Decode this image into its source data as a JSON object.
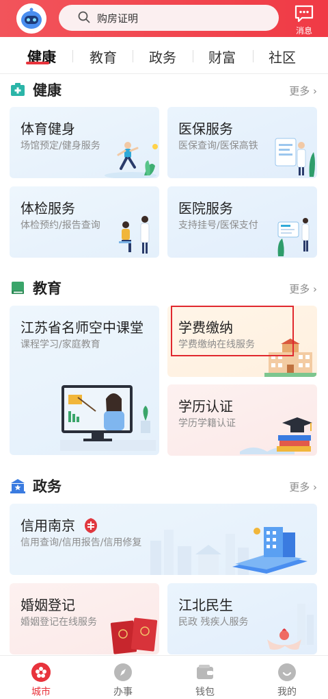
{
  "header": {
    "search_placeholder": "购房证明",
    "message_label": "消息"
  },
  "tabs": [
    {
      "label": "健康"
    },
    {
      "label": "教育"
    },
    {
      "label": "政务"
    },
    {
      "label": "财富"
    },
    {
      "label": "社区"
    }
  ],
  "sections": {
    "health": {
      "title": "健康",
      "more": "更多",
      "cards": [
        {
          "title": "体育健身",
          "subtitle": "场馆预定/健身服务"
        },
        {
          "title": "医保服务",
          "subtitle": "医保查询/医保高铁"
        },
        {
          "title": "体检服务",
          "subtitle": "体检预约/报告查询"
        },
        {
          "title": "医院服务",
          "subtitle": "支持挂号/医保支付"
        }
      ]
    },
    "education": {
      "title": "教育",
      "more": "更多",
      "cards": [
        {
          "title": "江苏省名师空中课堂",
          "subtitle": "课程学习/家庭教育"
        },
        {
          "title": "学费缴纳",
          "subtitle": "学费缴纳在线服务"
        },
        {
          "title": "学历认证",
          "subtitle": "学历学籍认证"
        }
      ]
    },
    "government": {
      "title": "政务",
      "more": "更多",
      "cards": [
        {
          "title": "信用南京",
          "subtitle": "信用查询/信用报告/信用修复"
        },
        {
          "title": "婚姻登记",
          "subtitle": "婚姻登记在线服务"
        },
        {
          "title": "江北民生",
          "subtitle": "民政 残疾人服务"
        }
      ]
    }
  },
  "bottom_nav": [
    {
      "label": "城市"
    },
    {
      "label": "办事"
    },
    {
      "label": "钱包"
    },
    {
      "label": "我的"
    }
  ],
  "colors": {
    "brand_red": "#e8333c",
    "health_icon": "#2bb5a8",
    "education_icon": "#3aa56a",
    "government_icon": "#3a7be0"
  }
}
